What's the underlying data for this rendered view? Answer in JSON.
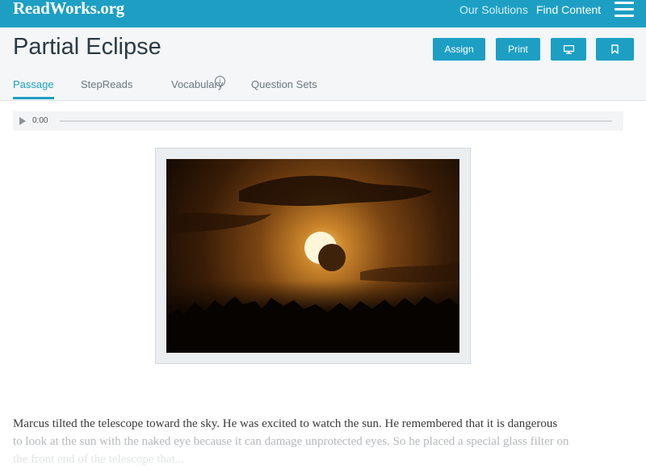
{
  "topbar": {
    "logo": "ReadWorks.org",
    "nav": [
      "Our Solutions",
      "Find Content"
    ]
  },
  "header": {
    "title": "Partial Eclipse",
    "buttons": {
      "assign": "Assign",
      "print": "Print"
    }
  },
  "tabs": [
    {
      "label": "Passage",
      "active": true
    },
    {
      "label": "StepReads",
      "info": "i"
    },
    {
      "label": "Vocabulary"
    },
    {
      "label": "Question Sets"
    }
  ],
  "audio": {
    "time": "0:00"
  },
  "passage": {
    "line1": "Marcus tilted the telescope toward the sky. He was excited to watch the sun. He remembered that it is dangerous",
    "line2": "to look at the sun with the naked eye because it can damage unprotected eyes. So he placed a special glass filter on",
    "line3": "the front end of the telescope that..."
  },
  "colors": {
    "brand": "#1d9fc4",
    "header_bg": "#f4f6f7"
  },
  "icons": [
    "hamburger-menu-icon",
    "info-icon",
    "play-icon",
    "monitor-icon",
    "bookmark-icon"
  ]
}
